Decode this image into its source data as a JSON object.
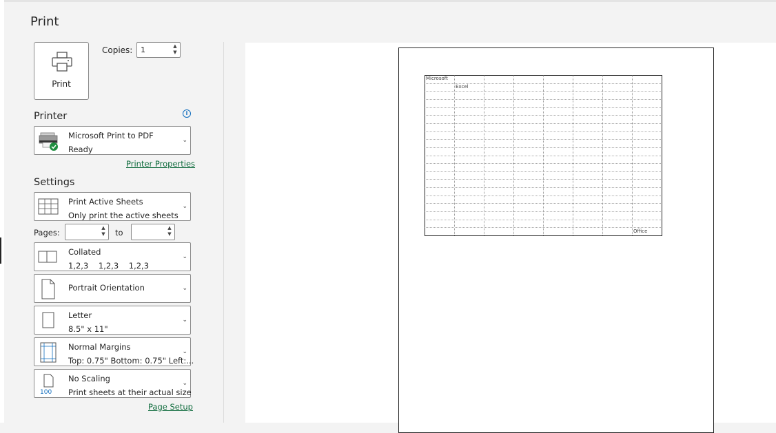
{
  "page_title": "Print",
  "print_button": {
    "label": "Print",
    "icon": "printer-icon"
  },
  "copies": {
    "label": "Copies:",
    "value": "1"
  },
  "printer": {
    "heading": "Printer",
    "name": "Microsoft Print to PDF",
    "status": "Ready",
    "properties_link": "Printer Properties",
    "info_icon": "info-icon",
    "status_color": "#1e8e3e"
  },
  "settings": {
    "heading": "Settings",
    "print_what": {
      "title": "Print Active Sheets",
      "subtitle": "Only print the active sheets"
    },
    "pages_label": "Pages:",
    "to_label": "to",
    "pages_from": "",
    "pages_to": "",
    "collation": {
      "title": "Collated",
      "subtitle": "1,2,3    1,2,3    1,2,3"
    },
    "orientation": {
      "title": "Portrait Orientation"
    },
    "paper_size": {
      "title": "Letter",
      "subtitle": "8.5\" x 11\""
    },
    "margins": {
      "title": "Normal Margins",
      "subtitle": "Top: 0.75\" Bottom: 0.75\" Left:..."
    },
    "scaling": {
      "title": "No Scaling",
      "subtitle": "Print sheets at their actual size",
      "icon_text": "100"
    },
    "page_setup_link": "Page Setup"
  },
  "preview": {
    "cells": {
      "a1": "Microsoft",
      "b2": "Excel",
      "h20": "Office"
    }
  },
  "colors": {
    "accent": "#0f6cbd",
    "link": "#0e6b3c",
    "background": "#f3f3f3"
  }
}
